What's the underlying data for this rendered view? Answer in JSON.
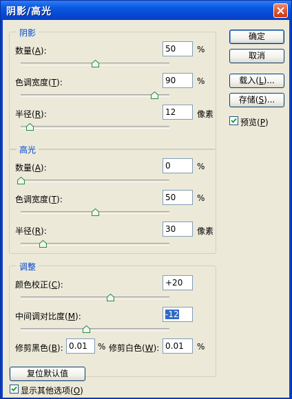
{
  "window": {
    "title": "阴影/高光"
  },
  "shadows": {
    "title": "阴影",
    "amount": {
      "label": "数量(",
      "key": "A",
      "tail": "):",
      "value": "50",
      "unit": "%",
      "level": 0.5
    },
    "tonal_width": {
      "label": "色调宽度(",
      "key": "T",
      "tail": "):",
      "value": "90",
      "unit": "%",
      "level": 0.9
    },
    "radius": {
      "label": "半径(",
      "key": "R",
      "tail": "):",
      "value": "12",
      "unit": "像素",
      "level": 0.06
    }
  },
  "highlights": {
    "title": "高光",
    "amount": {
      "label": "数量(",
      "key": "A",
      "tail": "):",
      "value": "0",
      "unit": "%",
      "level": 0.0
    },
    "tonal_width": {
      "label": "色调宽度(",
      "key": "T",
      "tail": "):",
      "value": "50",
      "unit": "%",
      "level": 0.5
    },
    "radius": {
      "label": "半径(",
      "key": "R",
      "tail": "):",
      "value": "30",
      "unit": "像素",
      "level": 0.15
    }
  },
  "adjustments": {
    "title": "调整",
    "color_correction": {
      "label": "颜色校正(",
      "key": "C",
      "tail": "):",
      "value": "+20",
      "level": 0.6
    },
    "midtone_contrast": {
      "label": "中间调对比度(",
      "key": "M",
      "tail": "):",
      "value": "-12",
      "level": 0.44
    },
    "black_clip": {
      "label": "修剪黑色(",
      "key": "B",
      "tail": "):",
      "value": "0.01",
      "unit": "%"
    },
    "white_clip": {
      "label": "修剪白色(",
      "key": "W",
      "tail": "):",
      "value": "0.01",
      "unit": "%"
    }
  },
  "buttons": {
    "ok": "确定",
    "cancel": "取消",
    "load": {
      "label": "载入(",
      "key": "L",
      "tail": ")..."
    },
    "save": {
      "label": "存储(",
      "key": "S",
      "tail": ")..."
    },
    "reset": "复位默认值"
  },
  "preview": {
    "label": "预览(",
    "key": "P",
    "tail": ")",
    "checked": true
  },
  "more_options": {
    "label": "显示其他选项(",
    "key": "O",
    "tail": ")",
    "checked": true
  },
  "colors": {
    "titlebar": "#0a5ae0",
    "dialog_bg": "#ece9d8",
    "group_title": "#0046d5",
    "selection": "#316ac5"
  }
}
